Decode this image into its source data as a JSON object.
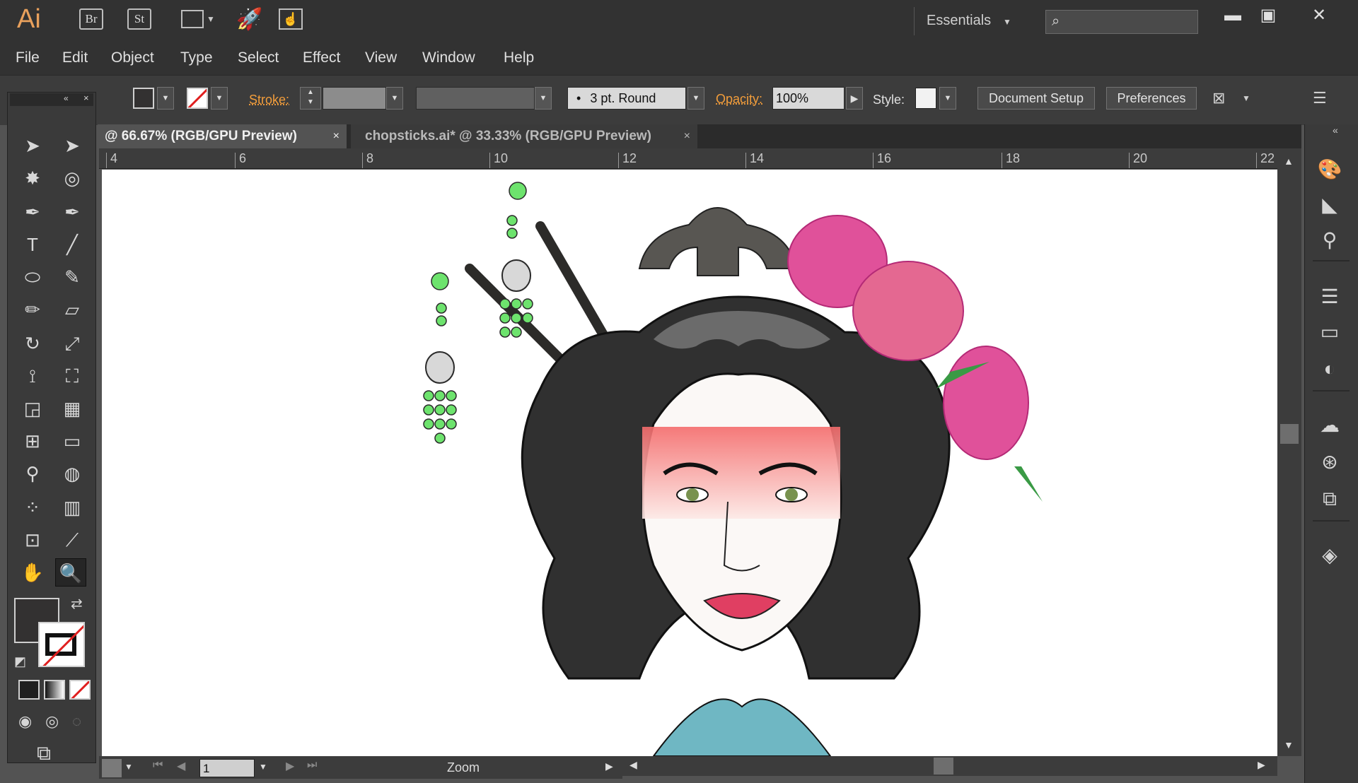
{
  "app": {
    "logo": "Ai",
    "bridge": "Br",
    "stock": "St"
  },
  "workspace": {
    "label": "Essentials"
  },
  "menu": [
    "File",
    "Edit",
    "Object",
    "Type",
    "Select",
    "Effect",
    "View",
    "Window",
    "Help"
  ],
  "control": {
    "stroke_label": "Stroke:",
    "brush": "3 pt. Round",
    "opacity_label": "Opacity:",
    "opacity_value": "100%",
    "style_label": "Style:",
    "doc_setup": "Document Setup",
    "preferences": "Preferences"
  },
  "tabs": [
    {
      "label": "@ 66.67% (RGB/GPU Preview)",
      "close": "×"
    },
    {
      "label": "chopsticks.ai* @ 33.33% (RGB/GPU Preview)",
      "close": "×"
    }
  ],
  "ruler": [
    "4",
    "6",
    "8",
    "10",
    "12",
    "14",
    "16",
    "18",
    "20",
    "22"
  ],
  "status": {
    "page": "1",
    "zoom_label": "Zoom"
  },
  "colors": {
    "accent": "#f29d3b",
    "fill": "#333131",
    "canvas": "#ffffff",
    "bead": "#6de36d",
    "flower": "#e0519a"
  }
}
